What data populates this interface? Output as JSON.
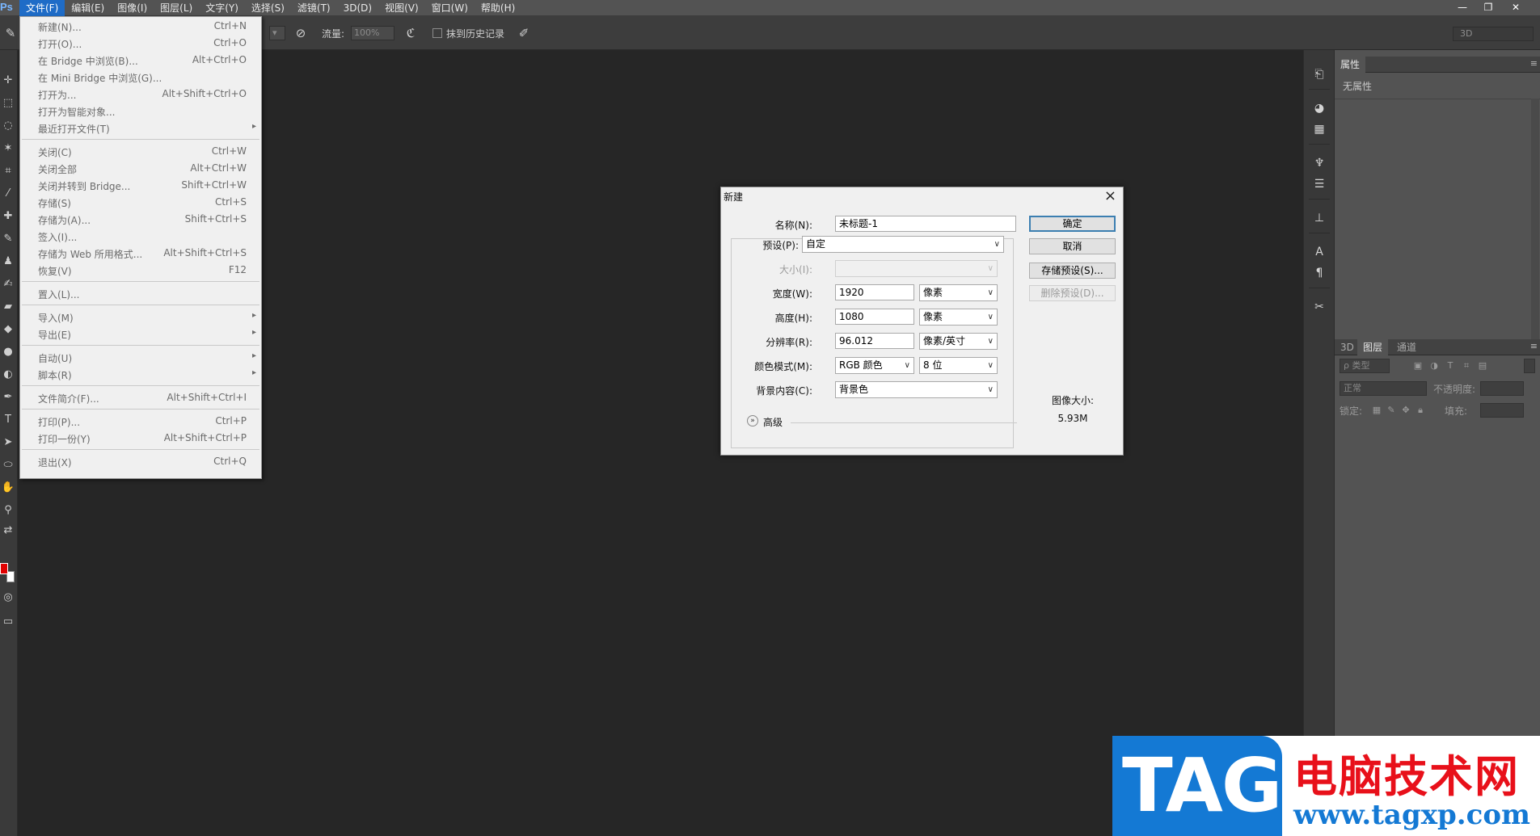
{
  "app": {
    "logo": "Ps",
    "menu": [
      "文件(F)",
      "编辑(E)",
      "图像(I)",
      "图层(L)",
      "文字(Y)",
      "选择(S)",
      "滤镜(T)",
      "3D(D)",
      "视图(V)",
      "窗口(W)",
      "帮助(H)"
    ],
    "window_controls": {
      "minimize": "—",
      "restore": "❐",
      "close": "✕"
    }
  },
  "options_bar": {
    "flow_label": "流量:",
    "flow_value": "100%",
    "erase_history_label": "抹到历史记录",
    "workspace": "3D"
  },
  "file_menu": {
    "items": [
      {
        "label": "新建(N)...",
        "shortcut": "Ctrl+N"
      },
      {
        "label": "打开(O)...",
        "shortcut": "Ctrl+O"
      },
      {
        "label": "在 Bridge 中浏览(B)...",
        "shortcut": "Alt+Ctrl+O"
      },
      {
        "label": "在 Mini Bridge 中浏览(G)...",
        "shortcut": ""
      },
      {
        "label": "打开为...",
        "shortcut": "Alt+Shift+Ctrl+O"
      },
      {
        "label": "打开为智能对象...",
        "shortcut": ""
      },
      {
        "label": "最近打开文件(T)",
        "shortcut": "",
        "submenu": true
      },
      {
        "label": "关闭(C)",
        "shortcut": "Ctrl+W"
      },
      {
        "label": "关闭全部",
        "shortcut": "Alt+Ctrl+W"
      },
      {
        "label": "关闭并转到 Bridge...",
        "shortcut": "Shift+Ctrl+W"
      },
      {
        "label": "存储(S)",
        "shortcut": "Ctrl+S"
      },
      {
        "label": "存储为(A)...",
        "shortcut": "Shift+Ctrl+S"
      },
      {
        "label": "签入(I)...",
        "shortcut": ""
      },
      {
        "label": "存储为 Web 所用格式...",
        "shortcut": "Alt+Shift+Ctrl+S"
      },
      {
        "label": "恢复(V)",
        "shortcut": "F12"
      },
      {
        "label": "置入(L)...",
        "shortcut": ""
      },
      {
        "label": "导入(M)",
        "shortcut": "",
        "submenu": true
      },
      {
        "label": "导出(E)",
        "shortcut": "",
        "submenu": true
      },
      {
        "label": "自动(U)",
        "shortcut": "",
        "submenu": true
      },
      {
        "label": "脚本(R)",
        "shortcut": "",
        "submenu": true
      },
      {
        "label": "文件简介(F)...",
        "shortcut": "Alt+Shift+Ctrl+I"
      },
      {
        "label": "打印(P)...",
        "shortcut": "Ctrl+P"
      },
      {
        "label": "打印一份(Y)",
        "shortcut": "Alt+Shift+Ctrl+P"
      },
      {
        "label": "退出(X)",
        "shortcut": "Ctrl+Q"
      }
    ]
  },
  "panels": {
    "properties": {
      "tab": "属性",
      "empty_text": "无属性"
    },
    "layers": {
      "tabs": [
        "3D",
        "图层",
        "通道"
      ],
      "filter_kind": "ρ 类型",
      "blend_mode": "正常",
      "opacity_label": "不透明度:",
      "lock_label": "锁定:",
      "fill_label": "填充:"
    }
  },
  "new_dialog": {
    "title": "新建",
    "name_label": "名称(N):",
    "name_value": "未标题-1",
    "preset_label": "预设(P):",
    "preset_value": "自定",
    "size_label": "大小(I):",
    "width_label": "宽度(W):",
    "width_value": "1920",
    "width_unit": "像素",
    "height_label": "高度(H):",
    "height_value": "1080",
    "height_unit": "像素",
    "resolution_label": "分辨率(R):",
    "resolution_value": "96.012",
    "resolution_unit": "像素/英寸",
    "color_mode_label": "颜色模式(M):",
    "color_mode_value": "RGB 颜色",
    "bit_depth": "8 位",
    "background_label": "背景内容(C):",
    "background_value": "背景色",
    "advanced_label": "高级",
    "ok_button": "确定",
    "cancel_button": "取消",
    "save_preset_button": "存储预设(S)...",
    "delete_preset_button": "删除预设(D)...",
    "image_size_label": "图像大小:",
    "image_size_value": "5.93M"
  },
  "watermark": {
    "logo": "TAG",
    "site_name": "电脑技术网",
    "url": "www.tagxp.com"
  }
}
